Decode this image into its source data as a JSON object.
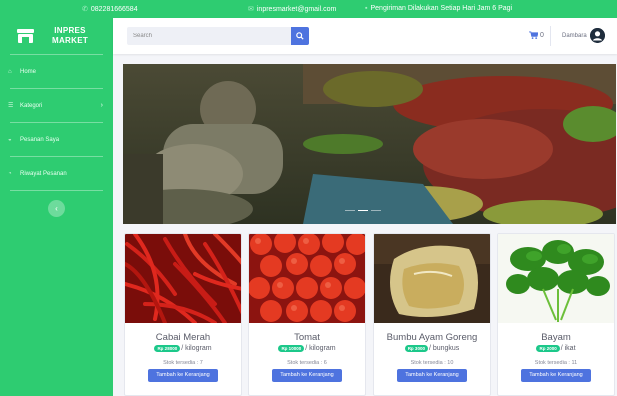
{
  "topbar": {
    "phone": "082281666584",
    "email": "inpresmarket@gmail.com",
    "notice": "Pengiriman Dilakukan Setiap Hari Jam 6 Pagi"
  },
  "brand": {
    "line1": "INPRES",
    "line2": "MARKET"
  },
  "sidebar": {
    "items": [
      {
        "label": "Home",
        "icon": "home-icon"
      },
      {
        "label": "Kategori",
        "icon": "list-icon",
        "chevron": "›"
      },
      {
        "label": "Pesanan Saya",
        "icon": "bag-icon"
      },
      {
        "label": "Riwayat Pesanan",
        "icon": "history-icon"
      }
    ],
    "collapse_glyph": "‹"
  },
  "header": {
    "search_placeholder": "Search",
    "cart_count": "0",
    "user_name": "Dambara"
  },
  "products": [
    {
      "name": "Cabai Merah",
      "price": "Rp 28000",
      "unit": "/ kilogram",
      "stock": "Stok tersedia : 7",
      "button": "Tambah ke Keranjang"
    },
    {
      "name": "Tomat",
      "price": "Rp 10000",
      "unit": "/ kilogram",
      "stock": "Stok tersedia : 6",
      "button": "Tambah ke Keranjang"
    },
    {
      "name": "Bumbu Ayam Goreng",
      "price": "Rp 3000",
      "unit": "/ bungkus",
      "stock": "Stok tersedia : 10",
      "button": "Tambah ke Keranjang"
    },
    {
      "name": "Bayam",
      "price": "Rp 2000",
      "unit": "/ ikat",
      "stock": "Stok tersedia : 11",
      "button": "Tambah ke Keranjang"
    }
  ],
  "colors": {
    "primary_green": "#2ecc71",
    "accent_blue": "#4e73df",
    "badge_green": "#1cc88a"
  }
}
